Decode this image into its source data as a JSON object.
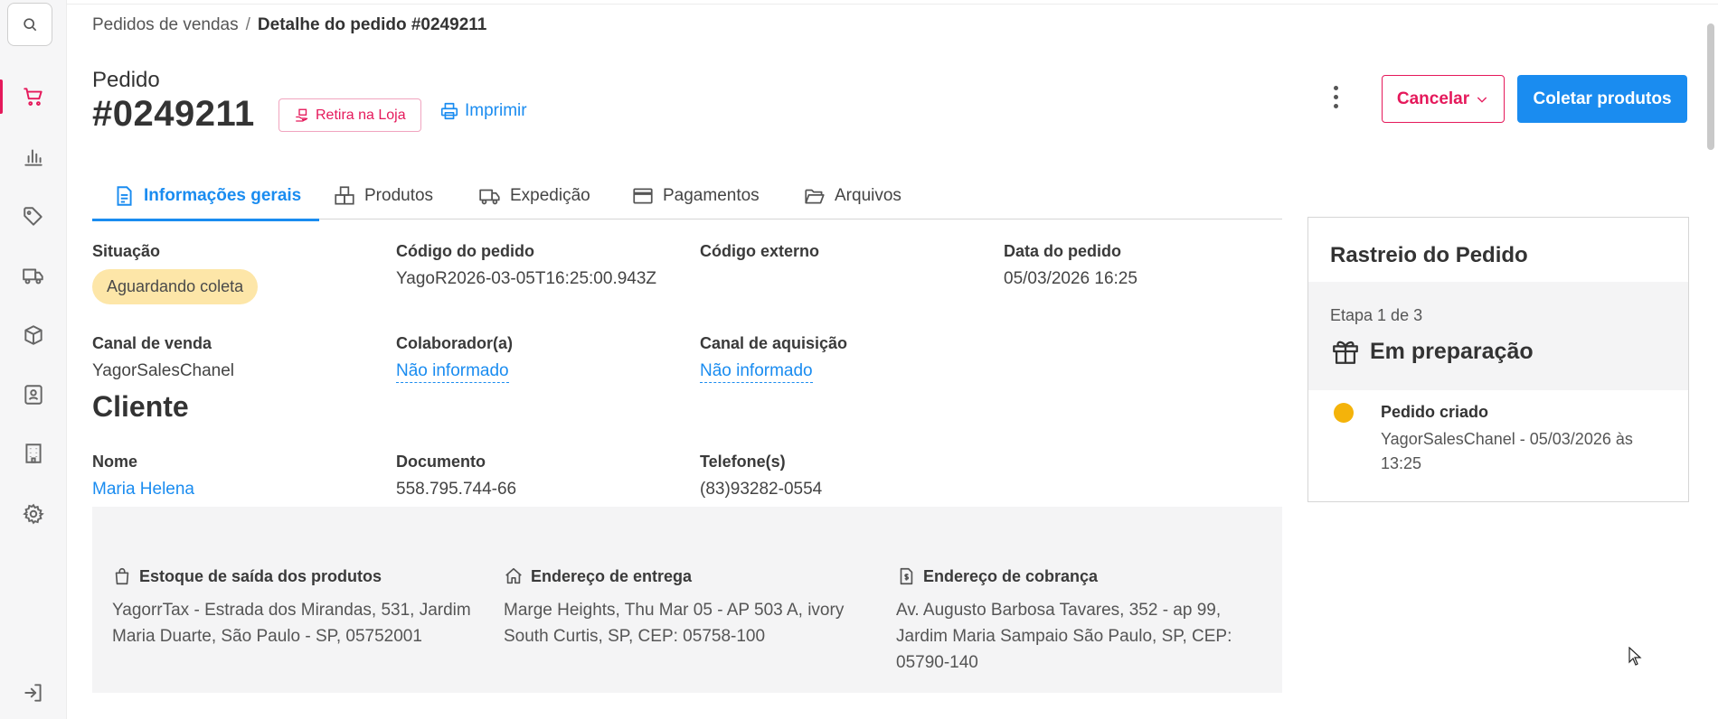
{
  "sidebar": {
    "items": [
      {
        "icon": "cart-icon",
        "active": true
      },
      {
        "icon": "bar-chart-icon"
      },
      {
        "icon": "tag-icon"
      },
      {
        "icon": "truck-icon"
      },
      {
        "icon": "box-icon"
      },
      {
        "icon": "contact-card-icon"
      },
      {
        "icon": "building-icon"
      },
      {
        "icon": "gear-icon"
      },
      {
        "icon": "logout-icon"
      }
    ]
  },
  "breadcrumb": {
    "parent": "Pedidos de vendas",
    "separator": "/",
    "current": "Detalhe do pedido #0249211"
  },
  "header": {
    "label": "Pedido",
    "number": "#0249211",
    "badge": "Retira na Loja",
    "print": "Imprimir",
    "cancel": "Cancelar",
    "collect": "Coletar produtos"
  },
  "tabs": [
    {
      "label": "Informações gerais",
      "icon": "document-icon",
      "active": true
    },
    {
      "label": "Produtos",
      "icon": "boxes-icon"
    },
    {
      "label": "Expedição",
      "icon": "truck-icon"
    },
    {
      "label": "Pagamentos",
      "icon": "credit-card-icon"
    },
    {
      "label": "Arquivos",
      "icon": "folder-icon"
    }
  ],
  "info": {
    "situacao": {
      "label": "Situação",
      "value": "Aguardando coleta"
    },
    "codigo_pedido": {
      "label": "Código do pedido",
      "value": "YagoR2026-03-05T16:25:00.943Z"
    },
    "codigo_externo": {
      "label": "Código externo",
      "value": ""
    },
    "data_pedido": {
      "label": "Data do pedido",
      "value": "05/03/2026 16:25"
    },
    "canal_venda": {
      "label": "Canal de venda",
      "value": "YagorSalesChanel"
    },
    "colaborador": {
      "label": "Colaborador(a)",
      "value": "Não informado"
    },
    "canal_aquisicao": {
      "label": "Canal de aquisição",
      "value": "Não informado"
    }
  },
  "cliente": {
    "title": "Cliente",
    "nome": {
      "label": "Nome",
      "value": "Maria Helena"
    },
    "documento": {
      "label": "Documento",
      "value": "558.795.744-66"
    },
    "telefone": {
      "label": "Telefone(s)",
      "value": "(83)93282-0554"
    }
  },
  "addresses": {
    "estoque": {
      "icon": "shopping-bag-icon",
      "label": "Estoque de saída dos produtos",
      "value": "YagorrTax - Estrada dos Mirandas, 531, Jardim Maria Duarte, São Paulo - SP, 05752001"
    },
    "entrega": {
      "icon": "home-icon",
      "label": "Endereço de entrega",
      "value": "Marge Heights, Thu Mar 05 - AP 503 A, ivory South Curtis, SP, CEP: 05758-100"
    },
    "cobranca": {
      "icon": "invoice-icon",
      "label": "Endereço de cobrança",
      "value": "Av. Augusto Barbosa Tavares, 352 - ap 99, Jardim Maria Sampaio São Paulo, SP, CEP: 05790-140"
    }
  },
  "tracking": {
    "title": "Rastreio do Pedido",
    "step": "Etapa 1 de 3",
    "stage": "Em preparação",
    "events": [
      {
        "title": "Pedido criado",
        "description": "YagorSalesChanel - 05/03/2026 às 13:25",
        "color": "#f4b30a"
      }
    ]
  },
  "colors": {
    "accent": "#1a8cf0",
    "brand": "#e5195b",
    "status_pending": "#fde6a8"
  }
}
